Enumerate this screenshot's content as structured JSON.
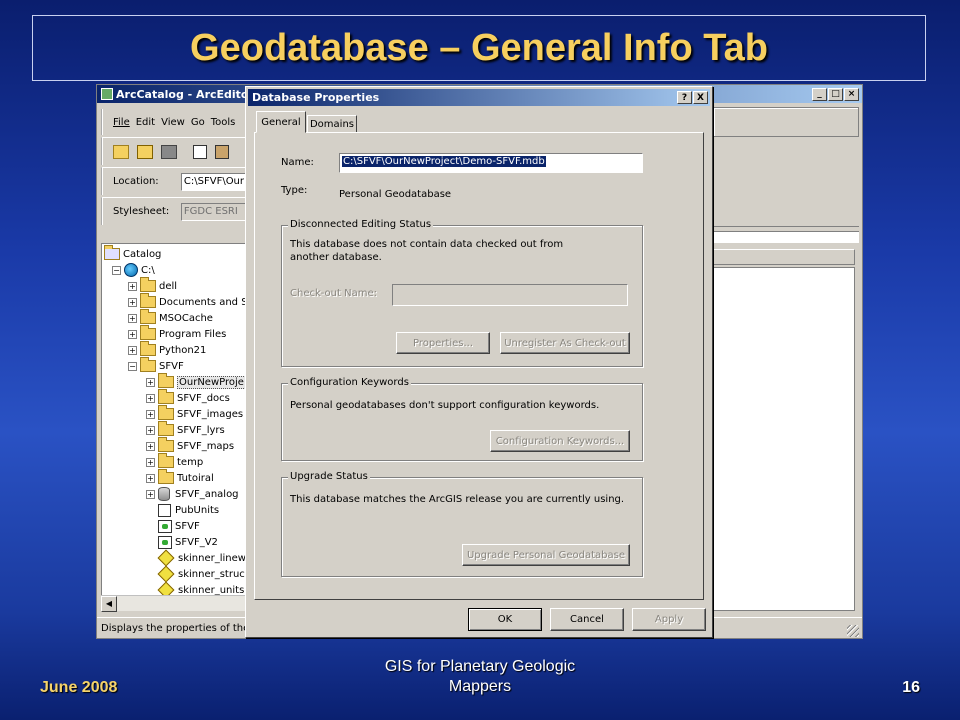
{
  "slide": {
    "title": "Geodatabase – General Info Tab",
    "footer_left": "June 2008",
    "footer_center": "GIS for Planetary Geologic Mappers",
    "footer_right": "16"
  },
  "arccatalog": {
    "title": "ArcCatalog - ArcEditor",
    "menu": [
      "File",
      "Edit",
      "View",
      "Go",
      "Tools"
    ],
    "location_label": "Location:",
    "location_value": "C:\\SFVF\\Our",
    "stylesheet_label": "Stylesheet:",
    "stylesheet_value": "FGDC ESRI",
    "status_text": "Displays the properties of the",
    "tree": [
      {
        "label": "Catalog",
        "icon": "catalog-icon"
      },
      {
        "label": "C:\\",
        "icon": "drive-icon"
      },
      {
        "label": "dell",
        "icon": "folder-icon"
      },
      {
        "label": "Documents and S",
        "icon": "folder-icon"
      },
      {
        "label": "MSOCache",
        "icon": "folder-icon"
      },
      {
        "label": "Program Files",
        "icon": "folder-icon"
      },
      {
        "label": "Python21",
        "icon": "folder-icon"
      },
      {
        "label": "SFVF",
        "icon": "folder-icon"
      },
      {
        "label": "OurNewProje",
        "icon": "folder-icon"
      },
      {
        "label": "SFVF_docs",
        "icon": "folder-icon"
      },
      {
        "label": "SFVF_images",
        "icon": "folder-icon"
      },
      {
        "label": "SFVF_lyrs",
        "icon": "folder-icon"
      },
      {
        "label": "SFVF_maps",
        "icon": "folder-icon"
      },
      {
        "label": "temp",
        "icon": "folder-icon"
      },
      {
        "label": "Tutoiral",
        "icon": "folder-icon"
      },
      {
        "label": "SFVF_analog",
        "icon": "geodatabase-icon"
      },
      {
        "label": "PubUnits",
        "icon": "table-icon"
      },
      {
        "label": "SFVF",
        "icon": "map-document-icon"
      },
      {
        "label": "SFVF_V2",
        "icon": "map-document-icon"
      },
      {
        "label": "skinner_linew",
        "icon": "shapefile-icon"
      },
      {
        "label": "skinner_struc",
        "icon": "shapefile-icon"
      },
      {
        "label": "skinner_units",
        "icon": "shapefile-icon"
      }
    ]
  },
  "dialog": {
    "title": "Database Properties",
    "help_btn": "?",
    "close_btn": "X",
    "tabs": [
      "General",
      "Domains"
    ],
    "name_label": "Name:",
    "name_value": "C:\\SFVF\\OurNewProject\\Demo-SFVF.mdb",
    "type_label": "Type:",
    "type_value": "Personal Geodatabase",
    "disconnected": {
      "label": "Disconnected Editing Status",
      "text": "This database does not contain data checked out from another database.",
      "checkout_label": "Check-out Name:",
      "properties_btn": "Properties...",
      "unregister_btn": "Unregister As Check-out"
    },
    "config": {
      "label": "Configuration Keywords",
      "text": "Personal geodatabases don't support configuration keywords.",
      "button": "Configuration Keywords..."
    },
    "upgrade": {
      "label": "Upgrade Status",
      "text": "This database matches the ArcGIS release you are currently using.",
      "button": "Upgrade Personal Geodatabase"
    },
    "ok": "OK",
    "cancel": "Cancel",
    "apply": "Apply"
  }
}
